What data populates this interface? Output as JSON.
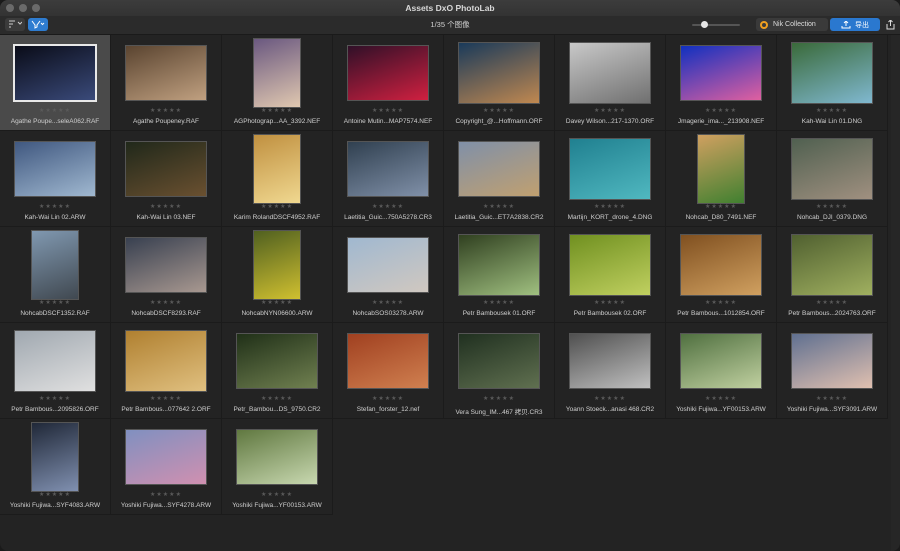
{
  "window": {
    "title": "Assets DxO PhotoLab"
  },
  "toolbar": {
    "sort_icon": "sort-icon",
    "filter_icon": "filter-icon",
    "count_text": "1/35 个图像",
    "nik_label": "Nik Collection",
    "export_label": "导出",
    "share_icon": "share-icon"
  },
  "stars_text": "★★★★★",
  "images": [
    {
      "name": "Agathe Poupe...seleA062.RAF",
      "w": 80,
      "h": 54,
      "c1": "#0a0c18",
      "c2": "#3a4a7a"
    },
    {
      "name": "Agathe Poupeney.RAF",
      "w": 80,
      "h": 54,
      "c1": "#5a4430",
      "c2": "#c0a080"
    },
    {
      "name": "AGPhotograp...AA_3392.NEF",
      "w": 46,
      "h": 68,
      "c1": "#6a5880",
      "c2": "#e0c8b0"
    },
    {
      "name": "Antoine Mutin...MAP7574.NEF",
      "w": 80,
      "h": 54,
      "c1": "#301028",
      "c2": "#d02040"
    },
    {
      "name": "Copyright_@...Hoffmann.ORF",
      "w": 80,
      "h": 60,
      "c1": "#1a3a5a",
      "c2": "#c08850"
    },
    {
      "name": "Davey Wilson...217-1370.ORF",
      "w": 80,
      "h": 60,
      "c1": "#c8c8c8",
      "c2": "#707070"
    },
    {
      "name": "Jmagerie_ima..._213908.NEF",
      "w": 80,
      "h": 54,
      "c1": "#1030c0",
      "c2": "#e060a0"
    },
    {
      "name": "Kah-Wai Lin 01.DNG",
      "w": 80,
      "h": 60,
      "c1": "#3a6a3a",
      "c2": "#80b8d0"
    },
    {
      "name": "Kah-Wai Lin 02.ARW",
      "w": 80,
      "h": 54,
      "c1": "#405880",
      "c2": "#a0b8d0"
    },
    {
      "name": "Kah-Wai Lin 03.NEF",
      "w": 80,
      "h": 54,
      "c1": "#20281a",
      "c2": "#6a5030"
    },
    {
      "name": "Karim RolandDSCF4952.RAF",
      "w": 46,
      "h": 68,
      "c1": "#c09040",
      "c2": "#f0d890"
    },
    {
      "name": "Laetitia_Guic...750A5278.CR3",
      "w": 80,
      "h": 54,
      "c1": "#304050",
      "c2": "#8090a8"
    },
    {
      "name": "Laetitia_Guic...ET7A2838.CR2",
      "w": 80,
      "h": 54,
      "c1": "#8090a8",
      "c2": "#c0a070"
    },
    {
      "name": "Martijn_KORT_drone_4.DNG",
      "w": 80,
      "h": 60,
      "c1": "#208090",
      "c2": "#50b8c0"
    },
    {
      "name": "Nohcab_D80_7491.NEF",
      "w": 46,
      "h": 68,
      "c1": "#d0a060",
      "c2": "#408030"
    },
    {
      "name": "Nohcab_DJI_0379.DNG",
      "w": 80,
      "h": 60,
      "c1": "#506050",
      "c2": "#a09080"
    },
    {
      "name": "NohcabDSCF1352.RAF",
      "w": 46,
      "h": 68,
      "c1": "#8098b0",
      "c2": "#404850"
    },
    {
      "name": "NohcabDSCF8293.RAF",
      "w": 80,
      "h": 54,
      "c1": "#384050",
      "c2": "#a89890"
    },
    {
      "name": "NohcabNYN06600.ARW",
      "w": 46,
      "h": 68,
      "c1": "#506020",
      "c2": "#d0c030"
    },
    {
      "name": "NohcabSOS03278.ARW",
      "w": 80,
      "h": 54,
      "c1": "#a0b8d0",
      "c2": "#d0c8c0"
    },
    {
      "name": "Petr Bambousek 01.ORF",
      "w": 80,
      "h": 60,
      "c1": "#304020",
      "c2": "#a0c080"
    },
    {
      "name": "Petr Bambousek 02.ORF",
      "w": 80,
      "h": 60,
      "c1": "#709020",
      "c2": "#c0d060"
    },
    {
      "name": "Petr Bambous...1012854.ORF",
      "w": 80,
      "h": 60,
      "c1": "#805020",
      "c2": "#d0a060"
    },
    {
      "name": "Petr Bambous...2024763.ORF",
      "w": 80,
      "h": 60,
      "c1": "#506030",
      "c2": "#a0b060"
    },
    {
      "name": "Petr Bambous...2095826.ORF",
      "w": 80,
      "h": 60,
      "c1": "#a0a8b0",
      "c2": "#e0e0e0"
    },
    {
      "name": "Petr Bambous...077642 2.ORF",
      "w": 80,
      "h": 60,
      "c1": "#b08030",
      "c2": "#e0c080"
    },
    {
      "name": "Petr_Bambou...DS_9750.CR2",
      "w": 80,
      "h": 54,
      "c1": "#203018",
      "c2": "#708050"
    },
    {
      "name": "Stefan_forster_12.nef",
      "w": 80,
      "h": 54,
      "c1": "#a04020",
      "c2": "#d08050"
    },
    {
      "name": "Vera Sung_IM...467 拷贝.CR3",
      "w": 80,
      "h": 54,
      "c1": "#203020",
      "c2": "#607050"
    },
    {
      "name": "Yoann Stoeck...anasi 468.CR2",
      "w": 80,
      "h": 54,
      "c1": "#505050",
      "c2": "#c0c0c0"
    },
    {
      "name": "Yoshiki Fujiwa...YF00153.ARW",
      "w": 80,
      "h": 54,
      "c1": "#507040",
      "c2": "#c0d0a0"
    },
    {
      "name": "Yoshiki Fujiwa...SYF3091.ARW",
      "w": 80,
      "h": 54,
      "c1": "#607090",
      "c2": "#e0c0b0"
    },
    {
      "name": "Yoshiki Fujiwa...SYF4083.ARW",
      "w": 46,
      "h": 68,
      "c1": "#202838",
      "c2": "#8090b0"
    },
    {
      "name": "Yoshiki Fujiwa...SYF4278.ARW",
      "w": 80,
      "h": 54,
      "c1": "#8090c0",
      "c2": "#d090b0"
    },
    {
      "name": "Yoshiki Fujiwa...YF00153.ARW",
      "w": 80,
      "h": 54,
      "c1": "#607840",
      "c2": "#c8d8b0"
    }
  ]
}
